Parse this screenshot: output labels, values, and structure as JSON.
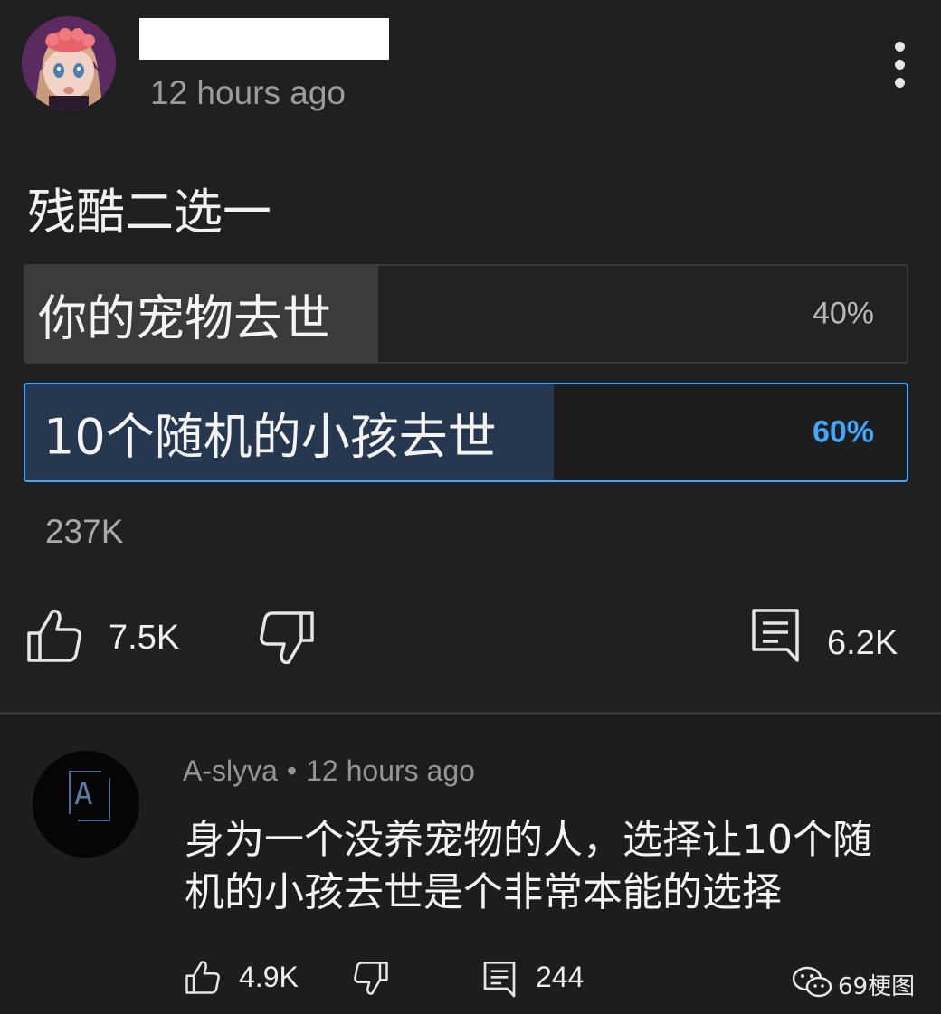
{
  "post": {
    "time": "12 hours ago",
    "text": "残酷二选一",
    "poll": [
      {
        "label": "你的宠物去世",
        "percent_text": "40%",
        "percent": 40
      },
      {
        "label": "10个随机的小孩去世",
        "percent_text": "60%",
        "percent": 60
      }
    ],
    "votes": "237K",
    "likes": "7.5K",
    "comments": "6.2K",
    "icons": {
      "like": "thumbs-up-icon",
      "dislike": "thumbs-down-icon",
      "comment": "comment-icon",
      "menu": "more-vert-icon"
    }
  },
  "comment": {
    "author": "A-slyva",
    "separator": "•",
    "time": "12 hours ago",
    "avatar_letter": "A",
    "text": "身为一个没养宠物的人，选择让10个随机的小孩去世是个非常本能的选择",
    "likes": "4.9K",
    "replies": "244"
  },
  "watermark": {
    "text": "69梗图",
    "icon": "wechat-icon"
  },
  "colors": {
    "background": "#1f1f1f",
    "accent": "#3ea6ff",
    "selected_fill": "#263850",
    "unselected_fill": "#3b3b3b"
  }
}
